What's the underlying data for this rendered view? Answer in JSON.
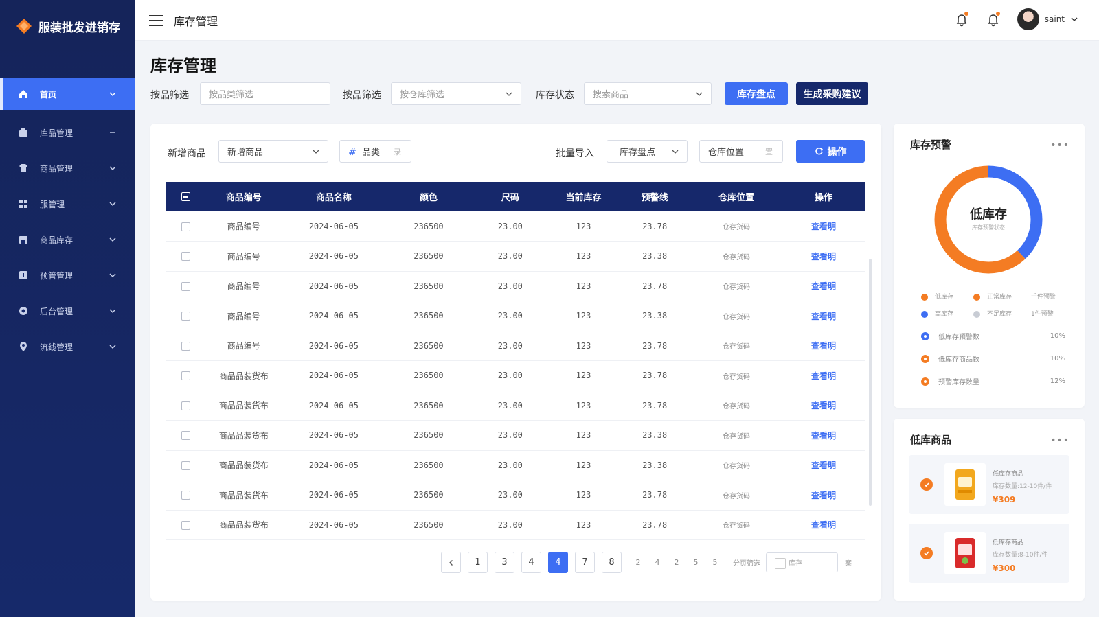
{
  "brand": {
    "name": "服装批发进销存"
  },
  "sidebar": {
    "items": [
      {
        "label": "首页",
        "icon": "home-icon",
        "active": true
      },
      {
        "label": "库品管理",
        "icon": "box-icon",
        "expanded": true
      },
      {
        "label": "商品管理",
        "icon": "shirt-icon"
      },
      {
        "label": "服管理",
        "icon": "grid-icon"
      },
      {
        "label": "商品库存",
        "icon": "store-icon"
      },
      {
        "label": "预管管理",
        "icon": "alert-icon"
      },
      {
        "label": "后台管理",
        "icon": "settings-icon"
      },
      {
        "label": "流线管理",
        "icon": "location-icon"
      }
    ]
  },
  "header": {
    "title": "库存管理",
    "username": "saint"
  },
  "page": {
    "title": "库存管理",
    "filters": [
      {
        "label": "按品筛选",
        "placeholder": "按品类筛选"
      },
      {
        "label": "按品筛选",
        "placeholder": "按仓库筛选"
      },
      {
        "label": "库存状态",
        "placeholder": "搜索商品"
      }
    ],
    "buttons": {
      "inventory": "库存盘点",
      "purchase": "生成采购建议"
    }
  },
  "toolbar": {
    "add_label": "新增商品",
    "add_select": "新增商品",
    "category": "品类",
    "category_suffix": "录",
    "import_label": "批量导入",
    "import_select": "库存盘点",
    "location": "仓库位置",
    "location_suffix": "置",
    "action_button": "操作"
  },
  "table": {
    "headers": [
      "商品编号",
      "商品名称",
      "颜色",
      "尺码",
      "当前库存",
      "预警线",
      "仓库位置",
      "操作"
    ],
    "rows": [
      [
        "商品编号",
        "2024-06-05",
        "236500",
        "23.00",
        "123",
        "23.78",
        "仓存货码",
        "查看明"
      ],
      [
        "商品编号",
        "2024-06-05",
        "236500",
        "23.00",
        "123",
        "23.38",
        "仓存货码",
        "查看明"
      ],
      [
        "商品编号",
        "2024-06-05",
        "236500",
        "23.00",
        "123",
        "23.78",
        "仓存货码",
        "查看明"
      ],
      [
        "商品编号",
        "2024-06-05",
        "236500",
        "23.00",
        "123",
        "23.38",
        "仓存货码",
        "查看明"
      ],
      [
        "商品编号",
        "2024-06-05",
        "236500",
        "23.00",
        "123",
        "23.78",
        "仓存货码",
        "查看明"
      ],
      [
        "商品品装货布",
        "2024-06-05",
        "236500",
        "23.00",
        "123",
        "23.78",
        "仓存货码",
        "查看明"
      ],
      [
        "商品品装货布",
        "2024-06-05",
        "236500",
        "23.00",
        "123",
        "23.78",
        "仓存货码",
        "查看明"
      ],
      [
        "商品品装货布",
        "2024-06-05",
        "236500",
        "23.00",
        "123",
        "23.38",
        "仓存货码",
        "查看明"
      ],
      [
        "商品品装货布",
        "2024-06-05",
        "236500",
        "23.00",
        "123",
        "23.38",
        "仓存货码",
        "查看明"
      ],
      [
        "商品品装货布",
        "2024-06-05",
        "236500",
        "23.00",
        "123",
        "23.78",
        "仓存货码",
        "查看明"
      ],
      [
        "商品品装货布",
        "2024-06-05",
        "236500",
        "23.00",
        "123",
        "23.78",
        "仓存货码",
        "查看明"
      ]
    ]
  },
  "pagination": {
    "pages": [
      "1",
      "3",
      "4",
      "4",
      "7",
      "8"
    ],
    "active_index": 3,
    "small_pages": [
      "2",
      "4",
      "2",
      "5",
      "5"
    ],
    "goto_label": "分页筛选",
    "goto_placeholder": "库存",
    "unit": "案"
  },
  "warning": {
    "title": "库存预警",
    "center_label": "低库存",
    "center_sub": "库存预警状态",
    "low_fraction": 0.62,
    "colors": {
      "orange": "#f47c23",
      "blue": "#3d6ef3",
      "gray": "#c8ccd4"
    },
    "legend": [
      {
        "label": "低库存",
        "color": "#f47c23"
      },
      {
        "label": "正常库存",
        "color": "#f47c23"
      },
      {
        "label": "千件预警",
        "color": ""
      },
      {
        "label": "高库存",
        "color": "#3d6ef3"
      },
      {
        "label": "不足库存",
        "color": "#c8ccd4"
      },
      {
        "label": "1件预警",
        "color": ""
      }
    ],
    "stats": [
      {
        "label": "低库存预警数",
        "value": "10%",
        "color": "#3d6ef3"
      },
      {
        "label": "低库存商品数",
        "value": "10%",
        "color": "#f47c23"
      },
      {
        "label": "预警库存数量",
        "value": "12%",
        "color": "#f47c23"
      }
    ]
  },
  "low_stock": {
    "title": "低库商品",
    "items": [
      {
        "name": "低库存商品",
        "meta": "库存数量:12-10件/件",
        "price": "¥309"
      },
      {
        "name": "低库存商品",
        "meta": "库存数量:8-10件/件",
        "price": "¥300"
      }
    ]
  }
}
